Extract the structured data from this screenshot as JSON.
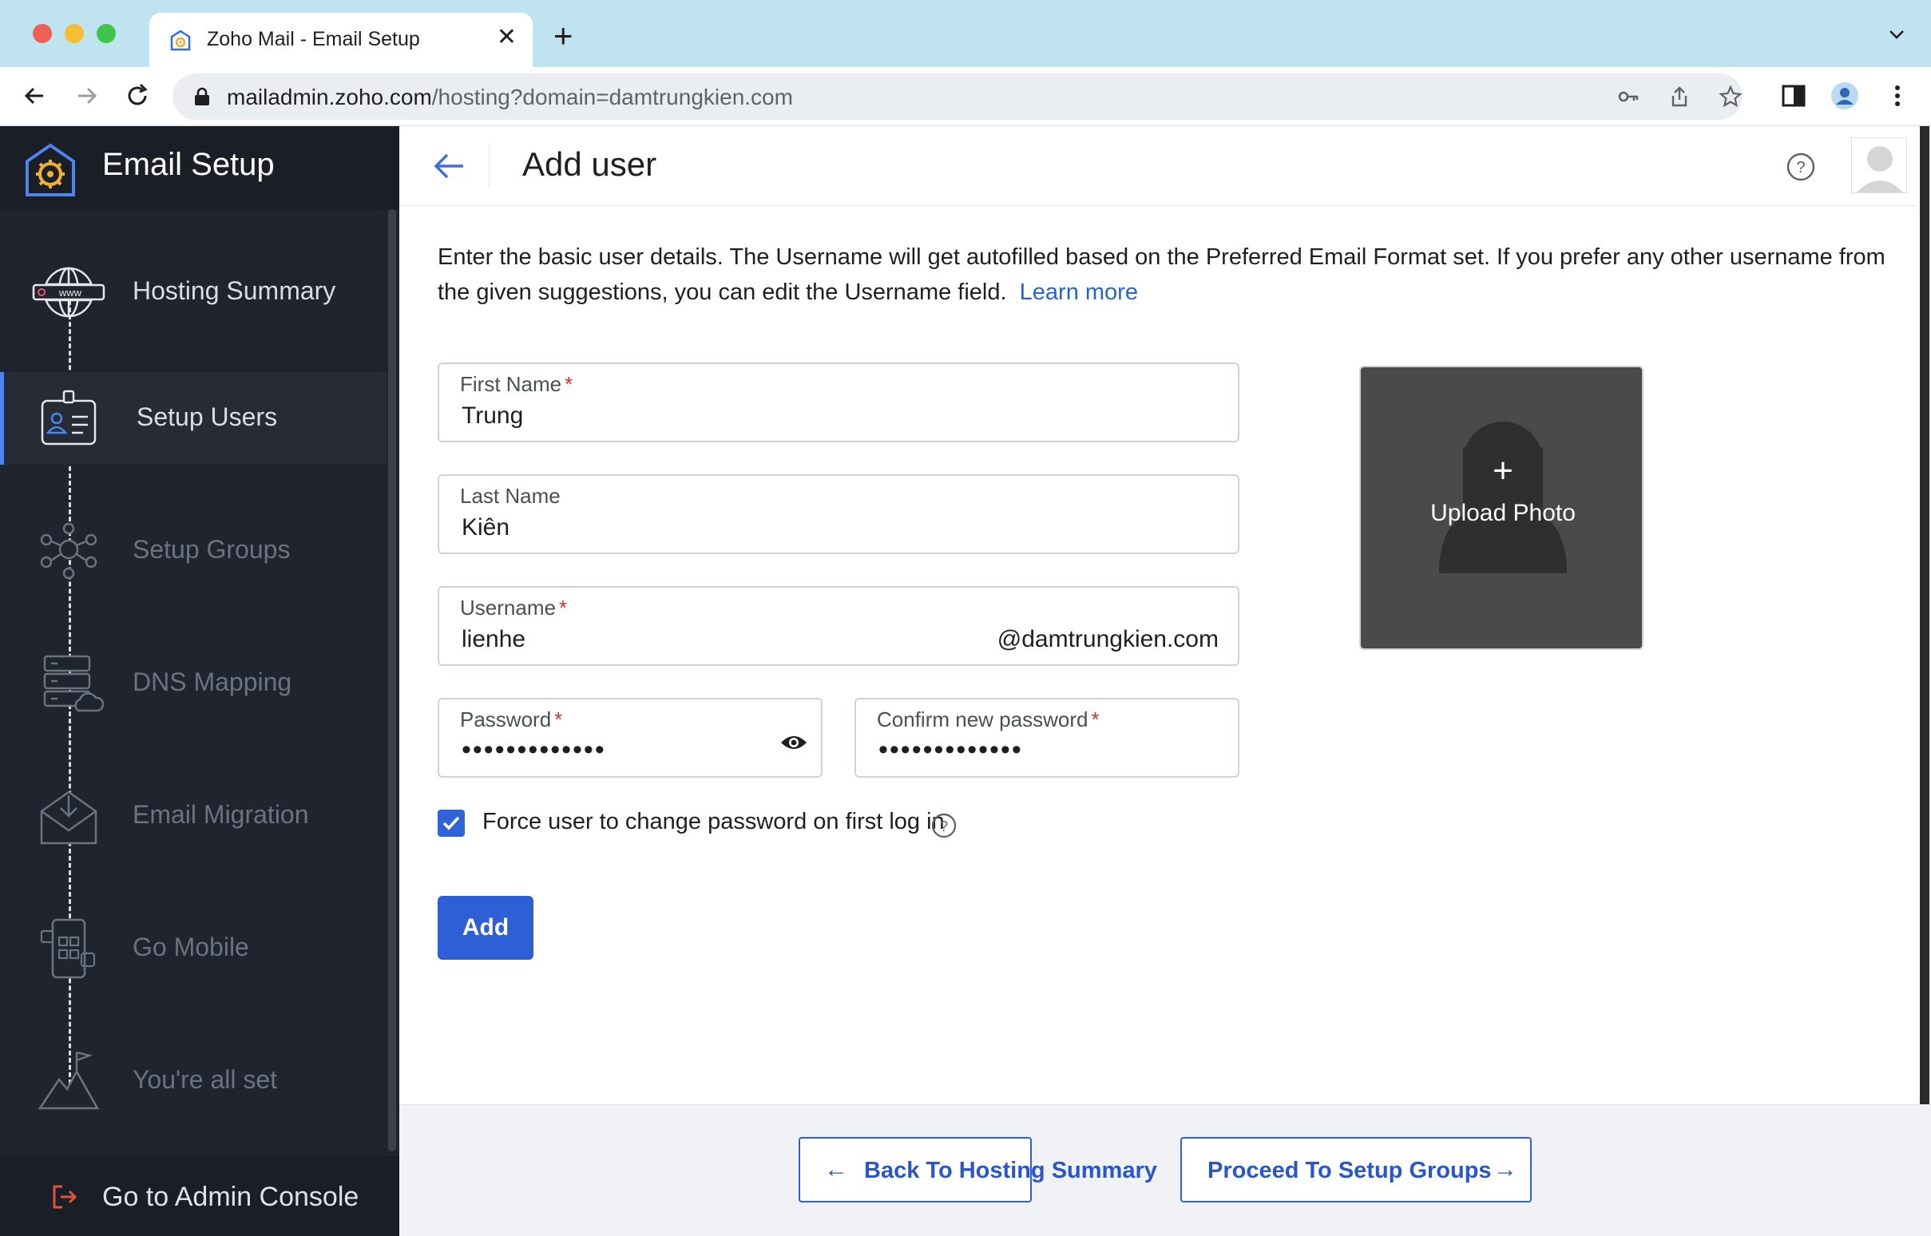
{
  "browser": {
    "tab_title": "Zoho Mail - Email Setup",
    "url_host": "mailadmin.zoho.com",
    "url_path": "/hosting?domain=damtrungkien.com"
  },
  "sidebar": {
    "title": "Email Setup",
    "items": [
      {
        "label": "Hosting Summary",
        "icon": "globe-www-icon",
        "state": "done"
      },
      {
        "label": "Setup Users",
        "icon": "id-badge-icon",
        "state": "active"
      },
      {
        "label": "Setup Groups",
        "icon": "group-network-icon",
        "state": "todo"
      },
      {
        "label": "DNS Mapping",
        "icon": "server-cloud-icon",
        "state": "todo"
      },
      {
        "label": "Email Migration",
        "icon": "envelope-download-icon",
        "state": "todo"
      },
      {
        "label": "Go Mobile",
        "icon": "mobile-apps-icon",
        "state": "todo"
      },
      {
        "label": "You're all set",
        "icon": "mountain-flag-icon",
        "state": "todo"
      }
    ],
    "footer_label": "Go to Admin Console"
  },
  "header": {
    "title": "Add user"
  },
  "intro": {
    "text": "Enter the basic user details. The Username will get autofilled based on the Preferred Email Format set. If you prefer any other username from the given suggestions, you can edit the Username field.",
    "link": "Learn more"
  },
  "form": {
    "first_name": {
      "label": "First Name",
      "value": "Trung",
      "required": true
    },
    "last_name": {
      "label": "Last Name",
      "value": "Kiên",
      "required": false
    },
    "username": {
      "label": "Username",
      "value": "lienhe",
      "suffix": "@damtrungkien.com",
      "required": true
    },
    "password": {
      "label": "Password",
      "value": "•••••••••••••",
      "required": true
    },
    "confirm_password": {
      "label": "Confirm new password",
      "value": "•••••••••••••",
      "required": true
    },
    "force_change": {
      "label": "Force user to change password on first log in",
      "checked": true
    },
    "add_label": "Add"
  },
  "photo": {
    "plus": "+",
    "label": "Upload Photo"
  },
  "footer": {
    "back_label": "Back To Hosting Summary",
    "back_arrow": "←",
    "next_label": "Proceed To Setup Groups",
    "next_arrow": "→"
  },
  "colors": {
    "accent": "#2f5fd6",
    "sidebar_bg": "#1f242e",
    "required": "#d6322d"
  }
}
